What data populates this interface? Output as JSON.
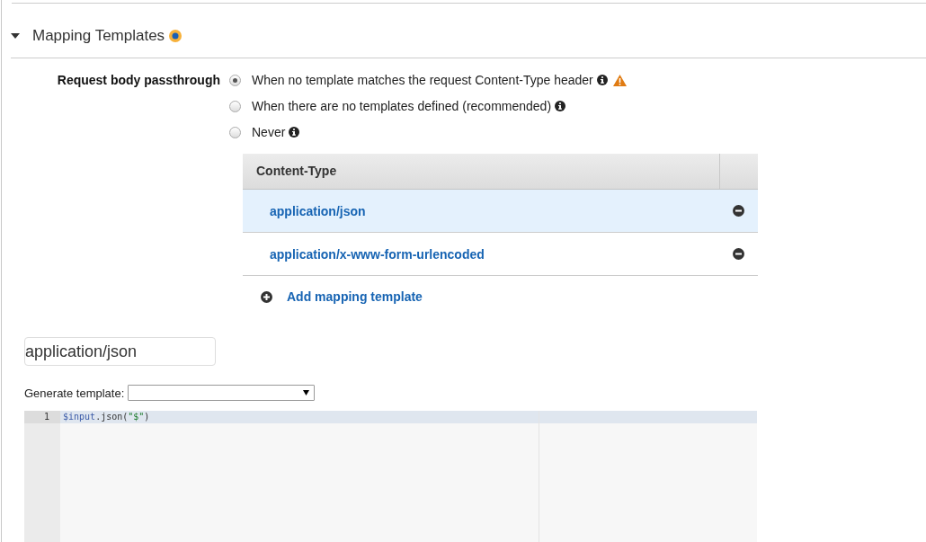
{
  "section": {
    "title": "Mapping Templates",
    "expanded": true
  },
  "passthrough": {
    "label": "Request body passthrough",
    "options": [
      {
        "label": "When no template matches the request Content-Type header",
        "selected": true,
        "warning": true
      },
      {
        "label": "When there are no templates defined (recommended)",
        "selected": false,
        "warning": false
      },
      {
        "label": "Never",
        "selected": false,
        "warning": false
      }
    ]
  },
  "table": {
    "columns": [
      "Content-Type"
    ],
    "rows": [
      {
        "content_type": "application/json",
        "selected": true
      },
      {
        "content_type": "application/x-www-form-urlencoded",
        "selected": false
      }
    ],
    "add_link": "Add mapping template"
  },
  "content_type_field": {
    "value": "application/json"
  },
  "generate_template": {
    "label": "Generate template:"
  },
  "editor": {
    "lines": [
      {
        "number": "1",
        "tokens": [
          {
            "kind": "variable",
            "text": "$input"
          },
          {
            "kind": "plain",
            "text": ".json("
          },
          {
            "kind": "string",
            "text": "\"$\""
          },
          {
            "kind": "plain",
            "text": ")"
          }
        ]
      }
    ]
  }
}
